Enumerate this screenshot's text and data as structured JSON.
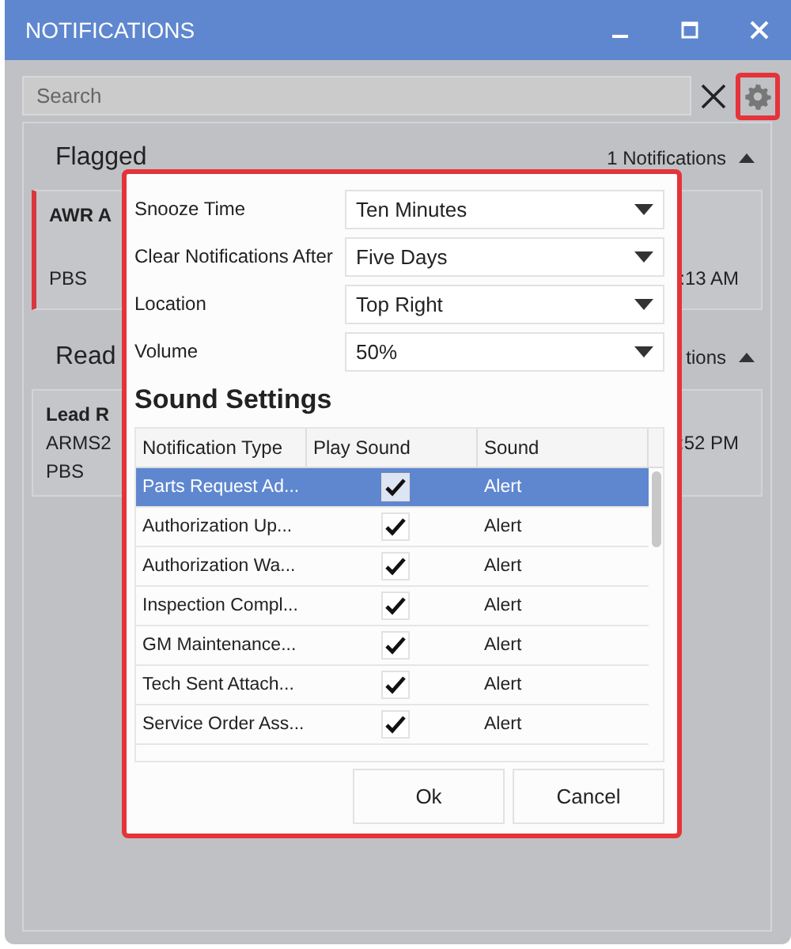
{
  "window": {
    "title": "NOTIFICATIONS"
  },
  "search": {
    "placeholder": "Search"
  },
  "sections": [
    {
      "title": "Flagged",
      "count": "1 Notifications",
      "expanded": true,
      "cards": [
        {
          "flagged": true,
          "left": [
            "AWR A",
            "PBS"
          ],
          "time": ":13 AM"
        }
      ]
    },
    {
      "title": "Read",
      "count": "tions",
      "expanded": true,
      "cards": [
        {
          "flagged": false,
          "left": [
            "Lead R",
            "ARMS2",
            "PBS"
          ],
          "time": ":52 PM"
        }
      ]
    }
  ],
  "dialog": {
    "settings": [
      {
        "label": "Snooze Time",
        "value": "Ten Minutes"
      },
      {
        "label": "Clear Notifications After",
        "value": "Five Days"
      },
      {
        "label": "Location",
        "value": "Top Right"
      },
      {
        "label": "Volume",
        "value": "50%"
      }
    ],
    "heading": "Sound Settings",
    "table": {
      "columns": [
        "Notification Type",
        "Play Sound",
        "Sound"
      ],
      "rows": [
        {
          "type": "Parts Request Ad...",
          "play_sound": true,
          "sound": "Alert",
          "selected": true
        },
        {
          "type": "Authorization Up...",
          "play_sound": true,
          "sound": "Alert",
          "selected": false
        },
        {
          "type": "Authorization Wa...",
          "play_sound": true,
          "sound": "Alert",
          "selected": false
        },
        {
          "type": "Inspection Compl...",
          "play_sound": true,
          "sound": "Alert",
          "selected": false
        },
        {
          "type": "GM Maintenance...",
          "play_sound": true,
          "sound": "Alert",
          "selected": false
        },
        {
          "type": "Tech Sent Attach...",
          "play_sound": true,
          "sound": "Alert",
          "selected": false
        },
        {
          "type": "Service Order Ass...",
          "play_sound": true,
          "sound": "Alert",
          "selected": false
        }
      ]
    },
    "buttons": [
      "Ok",
      "Cancel"
    ]
  }
}
